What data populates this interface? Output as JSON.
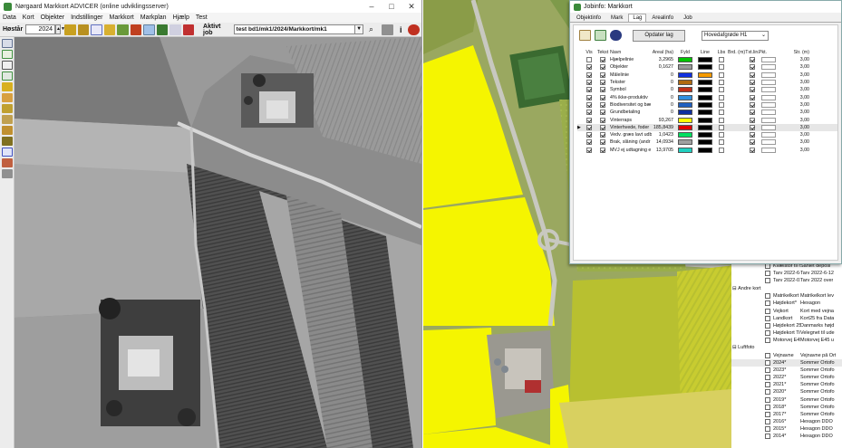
{
  "app": {
    "title": "Nørgaard Markkort ADVICER (online udviklingsserver)",
    "menu": [
      "Data",
      "Kort",
      "Objekter",
      "Indstillinger",
      "Markkort",
      "Markplan",
      "Hjælp",
      "Test"
    ],
    "harvest_label": "Høstår",
    "harvest_year": "2024",
    "active_job_label": "Aktivt job",
    "active_job_value": "test bd1/mk1/2024/Markkort/mk1"
  },
  "dialog": {
    "title": "Jobinfo: Markkort",
    "tabs": [
      "Objektinfo",
      "Mark",
      "Lag",
      "Arealinfo",
      "Job"
    ],
    "active_tab": "Lag",
    "update_button": "Opdater lag",
    "crop_select": "Hovedafgrøde H1",
    "columns": {
      "vis": "Vis",
      "tekst": "Tekst",
      "navn": "Navn",
      "areal": "Areal (ha)",
      "fyld": "Fyld",
      "line": "Line",
      "lbs": "Lbs",
      "brd": "Brd. (m)",
      "txtlin": "Txt.lin.",
      "pkt": "Pkt.",
      "str": "Str. (m)"
    },
    "rows": [
      {
        "vis": false,
        "tekst": true,
        "navn": "Hjælpelinie",
        "areal": "3,2965",
        "fyld": "#00c400",
        "line": "#000000",
        "lbs": false,
        "txtlin": true,
        "str": "3,00"
      },
      {
        "vis": true,
        "tekst": true,
        "navn": "Objekter",
        "areal": "0,1627",
        "fyld": "#9a9a9a",
        "line": "#000000",
        "lbs": false,
        "txtlin": true,
        "str": "3,00"
      },
      {
        "vis": true,
        "tekst": true,
        "navn": "Målelinie",
        "areal": "0",
        "fyld": "#1030e0",
        "line": "#f59a00",
        "lbs": false,
        "txtlin": true,
        "str": "3,00"
      },
      {
        "vis": true,
        "tekst": true,
        "navn": "Tekster",
        "areal": "0",
        "fyld": "#b06a10",
        "line": "#000000",
        "lbs": false,
        "txtlin": true,
        "str": "3,00"
      },
      {
        "vis": true,
        "tekst": true,
        "navn": "Symbol",
        "areal": "0",
        "fyld": "#c03018",
        "line": "#000000",
        "lbs": false,
        "txtlin": true,
        "str": "3,00"
      },
      {
        "vis": true,
        "tekst": true,
        "navn": "4% ikke-produktiv",
        "areal": "0",
        "fyld": "#3090e0",
        "line": "#000000",
        "lbs": false,
        "txtlin": true,
        "str": "3,00"
      },
      {
        "vis": true,
        "tekst": true,
        "navn": "Biodiversitet og bæ",
        "areal": "0",
        "fyld": "#2060c0",
        "line": "#000000",
        "lbs": false,
        "txtlin": true,
        "str": "3,00"
      },
      {
        "vis": true,
        "tekst": true,
        "navn": "Grundbetaling",
        "areal": "0",
        "fyld": "#1030a0",
        "line": "#000000",
        "lbs": false,
        "txtlin": true,
        "str": "3,00"
      },
      {
        "vis": true,
        "tekst": true,
        "navn": "Vinterraps",
        "areal": "93,267",
        "fyld": "#ffff00",
        "line": "#000000",
        "lbs": false,
        "txtlin": true,
        "str": "3,00"
      },
      {
        "vis": true,
        "tekst": true,
        "navn": "Vinterhvede, foder",
        "areal": "185,8439",
        "fyld": "#e00000",
        "line": "#000000",
        "lbs": false,
        "txtlin": true,
        "str": "3,00",
        "selected": true
      },
      {
        "vis": true,
        "tekst": true,
        "navn": "Vedv. græs lavt udb",
        "areal": "1,0423",
        "fyld": "#00e060",
        "line": "#000000",
        "lbs": false,
        "txtlin": true,
        "str": "3,00"
      },
      {
        "vis": true,
        "tekst": true,
        "navn": "Brak, slåning (andr",
        "areal": "14,0934",
        "fyld": "#a0a0a0",
        "line": "#000000",
        "lbs": false,
        "txtlin": true,
        "str": "3,00"
      },
      {
        "vis": true,
        "tekst": true,
        "navn": "MVJ ej udtagning e",
        "areal": "13,9705",
        "fyld": "#20d0c0",
        "line": "#000000",
        "lbs": false,
        "txtlin": true,
        "str": "3,00"
      }
    ]
  },
  "layer_panel": {
    "top_rows": [
      {
        "name": "Kvælstof til m",
        "desc": "Sanlet deposi"
      },
      {
        "name": "Tarv 2022-6-",
        "desc": "Tarv 2022-6-12"
      },
      {
        "name": "Tarv 2022-01",
        "desc": "Tarv 2022 over"
      }
    ],
    "groups": [
      {
        "title": "Andre kort",
        "rows": [
          {
            "name": "Matrikelkort",
            "desc": "Matrikelkort lev"
          },
          {
            "name": "Højdekort*",
            "desc": "Hexagon"
          },
          {
            "name": "Vejkort",
            "desc": "Kort med vejna"
          },
          {
            "name": "Landkort",
            "desc": "Kort25 fra Data"
          },
          {
            "name": "Højdekort 25",
            "desc": "Danmarks højd"
          },
          {
            "name": "Højdekort Tier",
            "desc": "Velegnet til ude"
          },
          {
            "name": "Motorvej E45 M",
            "desc": "Motorvej E45 u"
          }
        ]
      },
      {
        "title": "Luftfoto",
        "rows": [
          {
            "name": "Vejnavne",
            "desc": "Vejnavne på Ort"
          },
          {
            "name": "2024*",
            "desc": "Sommer Ortofo",
            "selected": true
          },
          {
            "name": "2023*",
            "desc": "Sommer Ortofo"
          },
          {
            "name": "2022*",
            "desc": "Sommer Ortofo"
          },
          {
            "name": "2021*",
            "desc": "Sommer Ortofo"
          },
          {
            "name": "2020*",
            "desc": "Sommer Ortofo"
          },
          {
            "name": "2019*",
            "desc": "Sommer Ortofo"
          },
          {
            "name": "2018*",
            "desc": "Sommer Ortofo"
          },
          {
            "name": "2017*",
            "desc": "Sommer Ortofo"
          },
          {
            "name": "2016*",
            "desc": "Hexagon DDO"
          },
          {
            "name": "2015*",
            "desc": "Hexagon DDO"
          },
          {
            "name": "2014*",
            "desc": "Hexagon DDO"
          }
        ]
      }
    ]
  },
  "colors": {
    "field_yellow": "#f5f500",
    "field_green": "#7f9a3a",
    "road": "#b8b8b0"
  },
  "icons": {
    "left_tools": [
      "zoom-icon",
      "page-icon",
      "pointer-icon",
      "select-area-icon",
      "pencil-icon",
      "layers-icon",
      "measure-icon",
      "hand-icon",
      "edit-icon",
      "tractor-icon",
      "text-abc-icon",
      "tools-icon",
      "print-icon"
    ]
  }
}
